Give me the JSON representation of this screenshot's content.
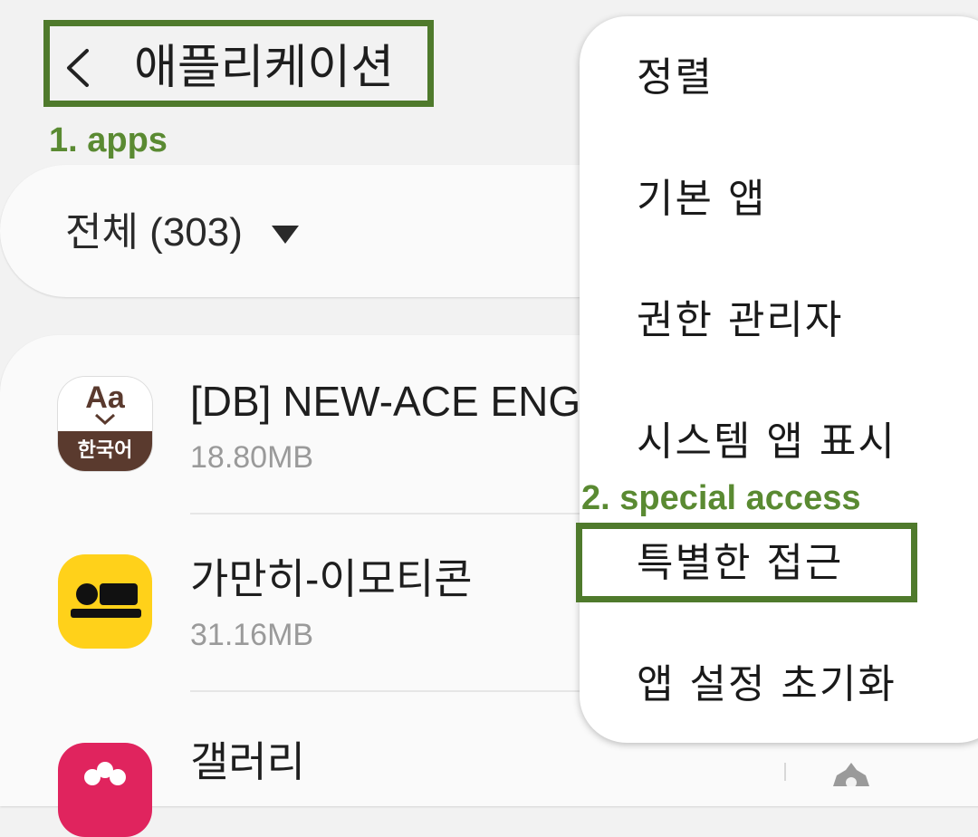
{
  "header": {
    "title": "애플리케이션",
    "annotation": "1. apps"
  },
  "filter": {
    "label": "전체 (303)"
  },
  "apps": [
    {
      "name": "[DB] NEW-ACE ENG",
      "size": "18.80MB",
      "icon": "korean-dictionary-icon",
      "icon_text_top": "Aa",
      "icon_text_band": "한국어"
    },
    {
      "name": "가만히-이모티콘",
      "size": "31.16MB",
      "icon": "emoticon-app-icon"
    },
    {
      "name": "갤러리",
      "size": "",
      "icon": "gallery-app-icon"
    }
  ],
  "menu": {
    "items": [
      {
        "label": "정렬"
      },
      {
        "label": "기본 앱"
      },
      {
        "label": "권한 관리자"
      },
      {
        "label": "시스템 앱 표시"
      },
      {
        "label": "특별한 접근"
      },
      {
        "label": "앱 설정 초기화"
      }
    ],
    "annotation": "2. special access"
  },
  "colors": {
    "highlight": "#4f7a2c",
    "annotation_text": "#5a8a32",
    "dict_brown": "#5a3a2e",
    "emoticon_yellow": "#ffd11a",
    "gallery_pink": "#e0245e"
  }
}
